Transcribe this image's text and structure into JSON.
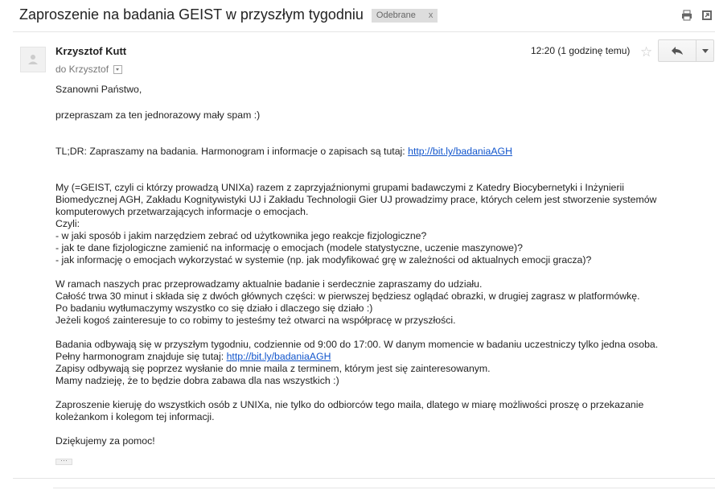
{
  "header": {
    "subject": "Zaproszenie na badania GEIST w przyszłym tygodniu",
    "label": "Odebrane",
    "label_remove": "x",
    "print_icon": "print-icon",
    "new_window_icon": "new-window-icon"
  },
  "message": {
    "sender": "Krzysztof Kutt",
    "to_label": "do Krzysztof",
    "time": "12:20 (1 godzinę temu)",
    "star_icon": "star-icon",
    "reply_icon": "reply-icon",
    "more_icon": "chevron-down-icon"
  },
  "body": {
    "greeting": "Szanowni Państwo,",
    "p1": "przepraszam za ten jednorazowy mały spam :)",
    "tldr_text": "TL;DR: Zapraszamy na badania. Harmonogram i informacje o zapisach są tutaj: ",
    "link1": "http://bit.ly/badaniaAGH",
    "p2_l1": "My (=GEIST, czyli ci którzy prowadzą UNIXa) razem z zaprzyjaźnionymi grupami badawczymi z Katedry Biocybernetyki i Inżynierii",
    "p2_l2": "Biomedycznej AGH, Zakładu Kognitywistyki UJ i Zakładu Technologii Gier UJ prowadzimy prace, których celem jest stworzenie systemów",
    "p2_l3": "komputerowych przetwarzających informacje o emocjach.",
    "p2_l4": "Czyli:",
    "p2_l5": "- w jaki sposób i jakim narzędziem zebrać od użytkownika jego reakcje fizjologiczne?",
    "p2_l6": "- jak te dane fizjologiczne zamienić na informację o emocjach (modele statystyczne, uczenie maszynowe)?",
    "p2_l7": "- jak informację o emocjach wykorzystać w systemie (np. jak modyfikować grę w zależności od aktualnych emocji gracza)?",
    "p3_l1": "W ramach naszych prac przeprowadzamy aktualnie badanie i serdecznie zapraszamy do udziału.",
    "p3_l2": "Całość trwa 30 minut i składa się z dwóch głównych części: w pierwszej będziesz oglądać obrazki, w drugiej zagrasz w platformówkę.",
    "p3_l3": "Po badaniu wytłumaczymy wszystko co się działo i dlaczego się działo :)",
    "p3_l4": "Jeżeli kogoś zainteresuje to co robimy to jesteśmy też otwarci na współpracę w przyszłości.",
    "p4_l1": "Badania odbywają się w przyszłym tygodniu, codziennie od 9:00 do 17:00. W danym momencie w badaniu uczestniczy tylko jedna osoba.",
    "p4_l2_text": "Pełny harmonogram znajduje się tutaj: ",
    "link2": "http://bit.ly/badaniaAGH",
    "p4_l3": "Zapisy odbywają się poprzez wysłanie do mnie maila z terminem, którym jest się zainteresowanym.",
    "p4_l4": "Mamy nadzieję, że to będzie dobra zabawa dla nas wszystkich :)",
    "p5_l1": "Zaproszenie kieruję do wszystkich osób z UNIXa, nie tylko do odbiorców tego maila, dlatego w miarę możliwości proszę o przekazanie",
    "p5_l2": "koleżankom i kolegom tej informacji.",
    "closing": "Dziękujemy za pomoc!",
    "ellipsis": "···"
  }
}
